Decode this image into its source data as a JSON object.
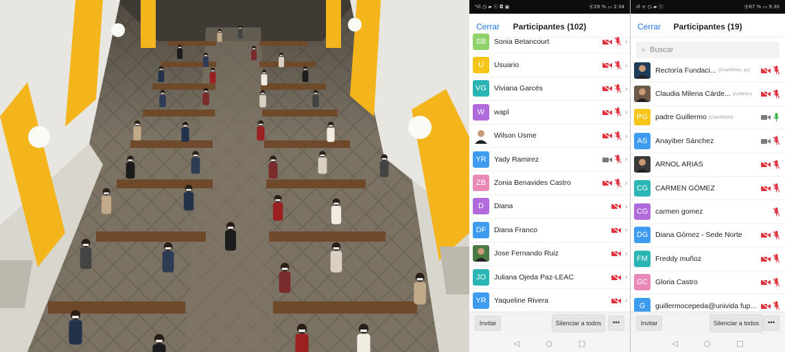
{
  "colors": {
    "accent": "#1a73e8",
    "mute_red": "#e0323c",
    "mic_green": "#3bb54a",
    "camera_gray": "#7a7a7a"
  },
  "phone_left": {
    "status_left": "⁴ıll ◷ ▰ ⓢ ◘ ▣",
    "status_right": "⦿28 % ▭ 2:34",
    "close_label": "Cerrar",
    "title": "Participantes (102)",
    "participants": [
      {
        "initials": "SB",
        "name": "Sonia Betancourt",
        "color": "#8fd16a",
        "video": "off",
        "audio": "muted"
      },
      {
        "initials": "U",
        "name": "Usuario",
        "color": "#f5c518",
        "video": "off",
        "audio": "muted"
      },
      {
        "initials": "VG",
        "name": "Viviana Garcés",
        "color": "#2bb5b5",
        "video": "off",
        "audio": "muted"
      },
      {
        "initials": "W",
        "name": "wapl",
        "color": "#b06ad9",
        "video": "off",
        "audio": "muted"
      },
      {
        "initials": "",
        "name": "Wilson Usme",
        "color": "#ffffff",
        "photo": true,
        "video": "off",
        "audio": "muted"
      },
      {
        "initials": "YR",
        "name": "Yady Ramirez",
        "color": "#3e9cf0",
        "video": "on",
        "audio": "muted"
      },
      {
        "initials": "ZB",
        "name": "Zonia Benavides Castro",
        "color": "#e889b8",
        "video": "off",
        "audio": "muted"
      },
      {
        "initials": "D",
        "name": "Diana",
        "color": "#b06ad9",
        "video": "off",
        "audio": "none"
      },
      {
        "initials": "DF",
        "name": "Diana Franco",
        "color": "#3e9cf0",
        "video": "off",
        "audio": "none"
      },
      {
        "initials": "",
        "name": "Jose Fernando Ruiz",
        "color": "#4a7a44",
        "photo": true,
        "video": "off",
        "audio": "none"
      },
      {
        "initials": "JO",
        "name": "Juliana Ojeda Paz-LEAC",
        "color": "#2bb5b5",
        "video": "off",
        "audio": "none"
      },
      {
        "initials": "YR",
        "name": "Yaqueline Rivera",
        "color": "#3e9cf0",
        "video": "off",
        "audio": "none"
      }
    ],
    "invite_label": "Invitar",
    "mute_all_label": "Silenciar a todos",
    "more_label": "•••",
    "nav": [
      "◁",
      "○",
      "□"
    ]
  },
  "phone_right": {
    "status_left": "ıll ᯤ ◷ ▰ ⓢ",
    "status_right": "⦿67 % ▭ 9:30",
    "close_label": "Cerrar",
    "title": "Participantes (19)",
    "search_placeholder": "Buscar",
    "participants": [
      {
        "initials": "",
        "name": "Rectoría Fundaci...",
        "role": "(Coanfitrión, yo)",
        "color": "#1f3c5a",
        "photo": true,
        "video": "off",
        "audio": "muted"
      },
      {
        "initials": "",
        "name": "Claudia Milena Cárde...",
        "role": "(Anfitrión)",
        "color": "#6b5a48",
        "photo": true,
        "video": "off",
        "audio": "muted"
      },
      {
        "initials": "PG",
        "name": "padre Guillermo",
        "role": "(Coanfitrión)",
        "color": "#f5c518",
        "video": "on",
        "audio": "on"
      },
      {
        "initials": "AS",
        "name": "Anayiber Sánchez",
        "role": "",
        "color": "#3e9cf0",
        "video": "on",
        "audio": "muted"
      },
      {
        "initials": "",
        "name": "ARNOL ARIAS",
        "role": "",
        "color": "#3a3a3a",
        "photo": true,
        "video": "off",
        "audio": "muted"
      },
      {
        "initials": "CG",
        "name": "CARMEN GÓMEZ",
        "role": "",
        "color": "#2bb5b5",
        "video": "off",
        "audio": "muted"
      },
      {
        "initials": "CG",
        "name": "carmen gomez",
        "role": "",
        "color": "#b06ad9",
        "video": "none",
        "audio": "muted"
      },
      {
        "initials": "DG",
        "name": "Diana Gómez - Sede Norte",
        "role": "",
        "color": "#3e9cf0",
        "video": "off",
        "audio": "muted"
      },
      {
        "initials": "FM",
        "name": "Freddy muñoz",
        "role": "",
        "color": "#2bb5b5",
        "video": "off",
        "audio": "muted"
      },
      {
        "initials": "GC",
        "name": "Gloria Castro",
        "role": "",
        "color": "#e889b8",
        "video": "off",
        "audio": "muted"
      },
      {
        "initials": "G",
        "name": "guillermocepeda@univida fup...",
        "role": "",
        "color": "#3e9cf0",
        "video": "off",
        "audio": "muted"
      }
    ],
    "invite_label": "Invitar",
    "mute_all_label": "Silenciar a todos",
    "more_label": "•••",
    "nav": [
      "◁",
      "○",
      "□"
    ]
  }
}
